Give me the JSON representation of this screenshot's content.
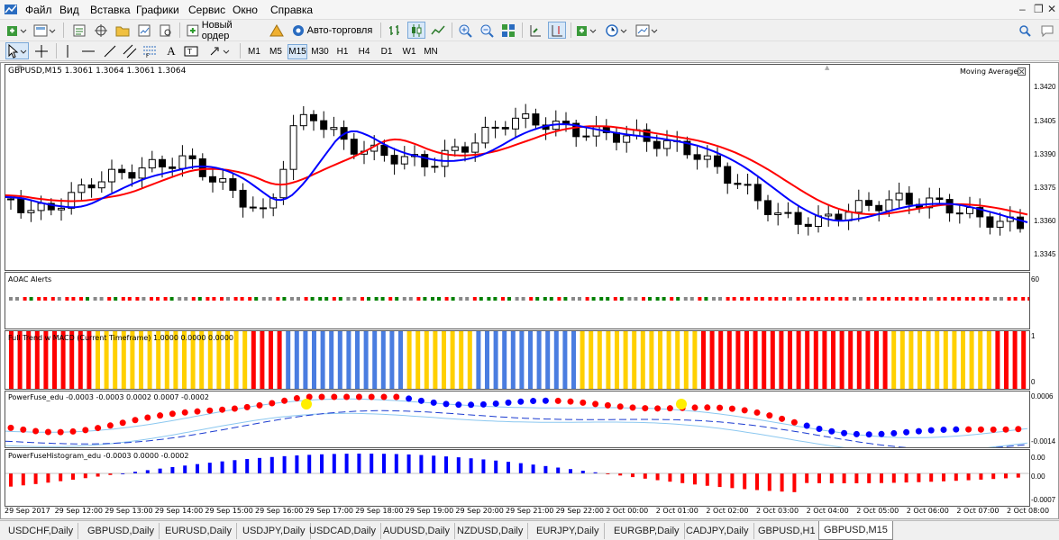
{
  "menu": {
    "items": [
      "Файл",
      "Вид",
      "Вставка",
      "Графики",
      "Сервис",
      "Окно",
      "Справка"
    ]
  },
  "toolbar": {
    "new_order": "Новый ордер",
    "auto_trading": "Авто-торговля",
    "timeframes": [
      "M1",
      "M5",
      "M15",
      "M30",
      "H1",
      "H4",
      "D1",
      "W1",
      "MN"
    ],
    "selected_timeframe": "M15"
  },
  "chart": {
    "title": "GBPUSD,M15  1.3061 1.3064 1.3061 1.3064",
    "ma_label": "Moving Average",
    "price_scale": [
      "1.3420",
      "1.3405",
      "1.3390",
      "1.3375",
      "1.3360",
      "1.3345"
    ],
    "aoac_label": "AOAC Alerts",
    "aoac_scale": "60",
    "fft_label": "Full Trend w MACD (Current Timeframe) 1.0000 0.0000 0.0000",
    "fft_scale": [
      "1",
      "0"
    ],
    "pf_label": "PowerFuse_edu -0.0003 -0.0003 0.0002 0.0007 -0.0002",
    "pf_scale": [
      "0.0006",
      "-0.0014"
    ],
    "pfh_label": "PowerFuseHistogram_edu -0.0003 0.0000 -0.0002",
    "pfh_scale": [
      "0.00",
      "0.00",
      "-0.0007"
    ],
    "time_axis": [
      "29 Sep 2017",
      "29 Sep 12:00",
      "29 Sep 13:00",
      "29 Sep 14:00",
      "29 Sep 15:00",
      "29 Sep 16:00",
      "29 Sep 17:00",
      "29 Sep 18:00",
      "29 Sep 19:00",
      "29 Sep 20:00",
      "29 Sep 21:00",
      "29 Sep 22:00",
      "2 Oct 00:00",
      "2 Oct 01:00",
      "2 Oct 02:00",
      "2 Oct 03:00",
      "2 Oct 04:00",
      "2 Oct 05:00",
      "2 Oct 06:00",
      "2 Oct 07:00",
      "2 Oct 08:00"
    ]
  },
  "colors": {
    "bull": "#ffffff",
    "bear": "#000000",
    "ma_fast": "#0000ff",
    "ma_slow": "#ff0000",
    "trend_red": "#ff0000",
    "trend_yellow": "#ffd000",
    "trend_blue": "#4a7de0",
    "aoac_green": "#008000",
    "aoac_red": "#ff0000",
    "aoac_gray": "#888888"
  },
  "tabs": [
    "USDCHF,Daily",
    "GBPUSD,Daily",
    "EURUSD,Daily",
    "USDJPY,Daily",
    "USDCAD,Daily",
    "AUDUSD,Daily",
    "NZDUSD,Daily",
    "EURJPY,Daily",
    "EURGBP,Daily",
    "CADJPY,Daily",
    "GBPUSD,H1",
    "GBPUSD,M15"
  ],
  "active_tab": "GBPUSD,M15"
}
